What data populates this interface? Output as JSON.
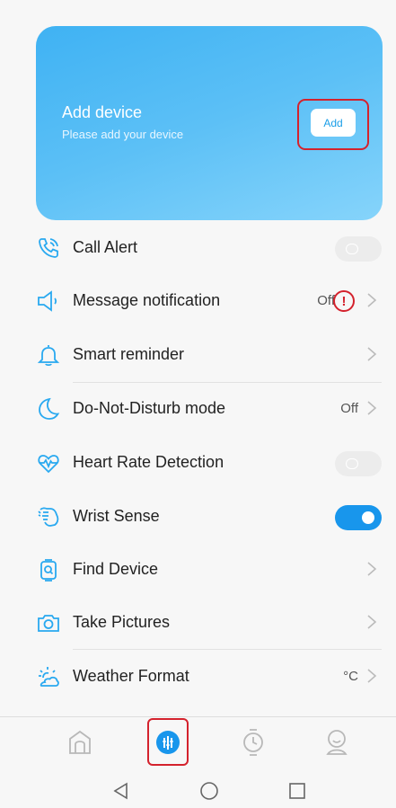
{
  "card": {
    "title": "Add device",
    "subtitle": "Please add your device",
    "button_label": "Add"
  },
  "settings": [
    {
      "label": "Call Alert",
      "icon": "phone-ring-icon",
      "control": "toggle-off"
    },
    {
      "label": "Message notification",
      "icon": "speaker-icon",
      "value": "Off",
      "control": "chevron",
      "alert": "!"
    },
    {
      "label": "Smart reminder",
      "icon": "bell-icon",
      "control": "chevron"
    },
    {
      "label": "Do-Not-Disturb mode",
      "icon": "moon-icon",
      "value": "Off",
      "control": "chevron"
    },
    {
      "label": "Heart Rate Detection",
      "icon": "heart-pulse-icon",
      "control": "toggle-off"
    },
    {
      "label": "Wrist Sense",
      "icon": "wrist-icon",
      "control": "toggle-on"
    },
    {
      "label": "Find Device",
      "icon": "find-device-icon",
      "control": "chevron"
    },
    {
      "label": "Take Pictures",
      "icon": "camera-icon",
      "control": "chevron"
    },
    {
      "label": "Weather Format",
      "icon": "weather-icon",
      "value": "°C",
      "control": "chevron"
    }
  ],
  "tabs": [
    "home-icon",
    "device-icon",
    "watch-icon",
    "profile-icon"
  ],
  "system_nav": [
    "back-icon",
    "home-circle-icon",
    "recents-icon"
  ],
  "colors": {
    "accent": "#1896ec",
    "icon": "#29a9f0",
    "highlight": "#d4222d"
  }
}
